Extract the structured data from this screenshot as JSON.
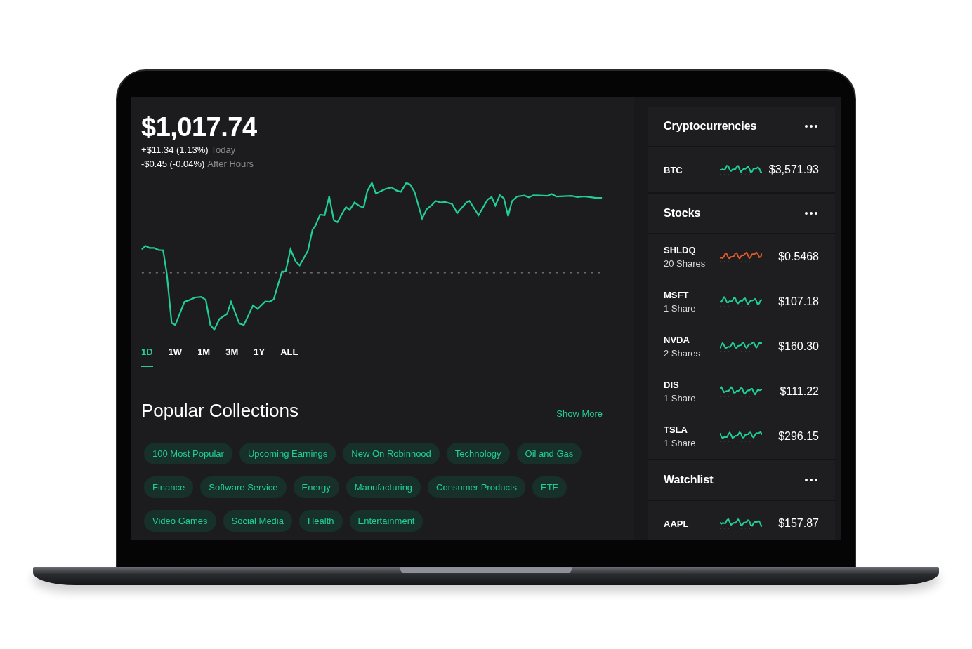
{
  "portfolio": {
    "value": "$1,017.74",
    "changes": [
      {
        "amount": "+$11.34 (1.13%)",
        "label": "Today"
      },
      {
        "amount": "-$0.45 (-0.04%)",
        "label": "After Hours"
      }
    ]
  },
  "ranges": [
    {
      "label": "1D",
      "selected": true
    },
    {
      "label": "1W",
      "selected": false
    },
    {
      "label": "1M",
      "selected": false
    },
    {
      "label": "3M",
      "selected": false
    },
    {
      "label": "1Y",
      "selected": false
    },
    {
      "label": "ALL",
      "selected": false
    }
  ],
  "collections": {
    "title": "Popular Collections",
    "link": "Show More",
    "items": [
      "100 Most Popular",
      "Upcoming Earnings",
      "New On Robinhood",
      "Technology",
      "Oil and Gas",
      "Finance",
      "Software Service",
      "Energy",
      "Manufacturing",
      "Consumer Products",
      "ETF",
      "Video Games",
      "Social Media",
      "Health",
      "Entertainment"
    ]
  },
  "sections": [
    {
      "title": "Cryptocurrencies",
      "rows": [
        {
          "symbol": "BTC",
          "price": "$3,571.93",
          "color": "#21ce99"
        }
      ]
    },
    {
      "title": "Stocks",
      "rows": [
        {
          "symbol": "SHLDQ",
          "shares": "20 Shares",
          "price": "$0.5468",
          "color": "#e05a2b"
        },
        {
          "symbol": "MSFT",
          "shares": "1 Share",
          "price": "$107.18",
          "color": "#21ce99"
        },
        {
          "symbol": "NVDA",
          "shares": "2 Shares",
          "price": "$160.30",
          "color": "#21ce99"
        },
        {
          "symbol": "DIS",
          "shares": "1 Share",
          "price": "$111.22",
          "color": "#21ce99"
        },
        {
          "symbol": "TSLA",
          "shares": "1 Share",
          "price": "$296.15",
          "color": "#21ce99"
        }
      ]
    },
    {
      "title": "Watchlist",
      "rows": [
        {
          "symbol": "AAPL",
          "price": "$157.87",
          "color": "#21ce99"
        }
      ]
    }
  ]
}
